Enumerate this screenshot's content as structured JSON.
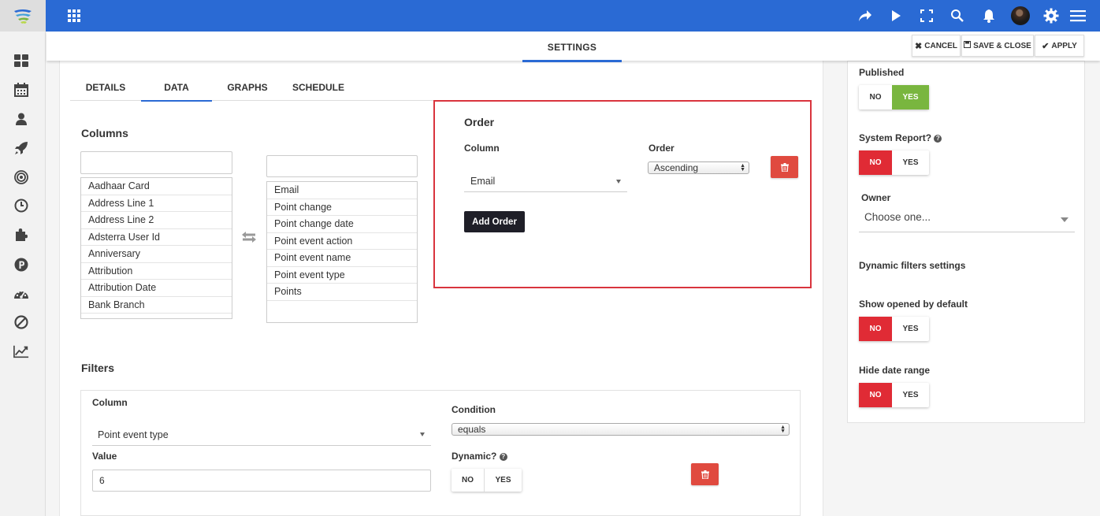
{
  "header": {
    "settings_tab": "SETTINGS",
    "cancel": "CANCEL",
    "save_close": "SAVE & CLOSE",
    "apply": "APPLY"
  },
  "tabs": [
    "DETAILS",
    "DATA",
    "GRAPHS",
    "SCHEDULE"
  ],
  "active_tab": "DATA",
  "columns": {
    "title": "Columns",
    "available_search": "",
    "selected_search": "",
    "available": [
      "Aadhaar Card",
      "Address Line 1",
      "Address Line 2",
      "Adsterra User Id",
      "Anniversary",
      "Attribution",
      "Attribution Date",
      "Bank Branch"
    ],
    "selected": [
      "Email",
      "Point change",
      "Point change date",
      "Point event action",
      "Point event name",
      "Point event type",
      "Points"
    ]
  },
  "order": {
    "title": "Order",
    "column_label": "Column",
    "column_value": "Email",
    "order_label": "Order",
    "order_value": "Ascending",
    "add_button": "Add Order"
  },
  "filters": {
    "title": "Filters",
    "column_label": "Column",
    "column_value": "Point event type",
    "condition_label": "Condition",
    "condition_value": "equals",
    "value_label": "Value",
    "value": "6",
    "dynamic_label": "Dynamic?",
    "no": "NO",
    "yes": "YES"
  },
  "right_panel": {
    "published_label": "Published",
    "system_report_label": "System Report?",
    "owner_label": "Owner",
    "owner_placeholder": "Choose one...",
    "dynamic_filters_label": "Dynamic filters settings",
    "show_opened_label": "Show opened by default",
    "hide_date_label": "Hide date range",
    "no": "NO",
    "yes": "YES"
  },
  "colors": {
    "brand_blue": "#2a6ad4",
    "red": "#e02b35",
    "green": "#79b63f",
    "highlight_border": "#d9343d"
  },
  "icons": [
    "apps-grid-icon",
    "share-icon",
    "play-icon",
    "fullscreen-icon",
    "search-icon",
    "bell-icon",
    "gear-icon",
    "hamburger-menu-icon",
    "dashboard-icon",
    "calendar-icon",
    "user-icon",
    "rocket-icon",
    "target-icon",
    "clock-icon",
    "puzzle-icon",
    "points-icon",
    "speedometer-icon",
    "ban-icon",
    "chart-line-icon",
    "swap-arrows-icon",
    "trash-icon",
    "help-circle-icon"
  ]
}
